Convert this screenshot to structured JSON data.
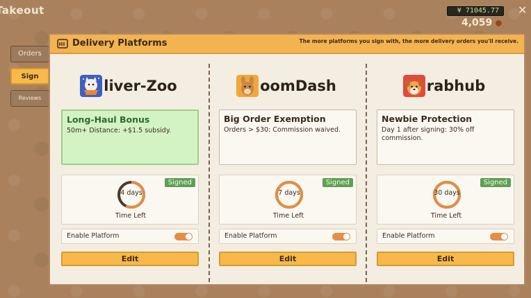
{
  "app": {
    "title": "Takeout"
  },
  "wallet": {
    "money": "¥ 71045.77",
    "coins": "4,059"
  },
  "sidebar": {
    "items": [
      {
        "label": "Orders"
      },
      {
        "label": "Sign"
      },
      {
        "label": "Reviews"
      }
    ]
  },
  "panel": {
    "title": "Delivery Platforms",
    "hint": "The more platforms you sign with, the more delivery orders you'll receive."
  },
  "platforms": [
    {
      "name": "liver-Zoo",
      "logo": "cat-bowl-icon",
      "bonus_title": "Long-Haul Bonus",
      "bonus_desc": "50m+ Distance: +$1.5 subsidy.",
      "highlighted": true,
      "signed": "Signed",
      "days": "4 days",
      "days_fraction": 0.57,
      "time_left": "Time Left",
      "enable_label": "Enable Platform",
      "enabled": true,
      "edit_label": "Edit"
    },
    {
      "name": "oomDash",
      "logo": "kangaroo-icon",
      "bonus_title": "Big Order Exemption",
      "bonus_desc": "Orders > $30: Commission waived.",
      "highlighted": false,
      "signed": "Signed",
      "days": "7 days",
      "days_fraction": 1.0,
      "time_left": "Time Left",
      "enable_label": "Enable Platform",
      "enabled": true,
      "edit_label": "Edit"
    },
    {
      "name": "rabhub",
      "logo": "dog-icon",
      "bonus_title": "Newbie Protection",
      "bonus_desc": "Day 1 after signing: 30% off commission.",
      "highlighted": false,
      "signed": "Signed",
      "days": "30 days",
      "days_fraction": 1.0,
      "time_left": "Time Left",
      "enable_label": "Enable Platform",
      "enabled": true,
      "edit_label": "Edit"
    }
  ],
  "colors": {
    "accent": "#f7b949",
    "ring": "#e58e44",
    "ring_track": "#4a3a2e",
    "signed": "#5f9f53",
    "highlight_bg": "#d4f3c5"
  }
}
